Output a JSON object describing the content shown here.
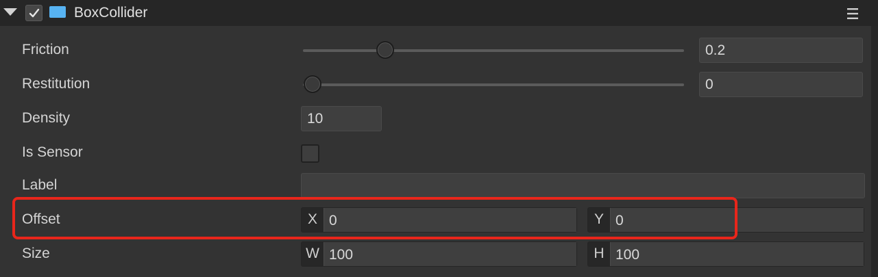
{
  "component": {
    "title": "BoxCollider",
    "enabled": true,
    "accent_color": "#57b3f2",
    "icons": [
      "fold-arrow-icon",
      "checkmark-icon",
      "component-icon",
      "menu-icon"
    ]
  },
  "properties": {
    "friction": {
      "label": "Friction",
      "value": "0.2",
      "slider_fraction": 0.2
    },
    "restitution": {
      "label": "Restitution",
      "value": "0",
      "slider_fraction": 0.0
    },
    "density": {
      "label": "Density",
      "value": "10"
    },
    "is_sensor": {
      "label": "Is Sensor",
      "checked": false
    },
    "label": {
      "label": "Label",
      "value": ""
    },
    "offset": {
      "label": "Offset",
      "x_label": "X",
      "x_value": "0",
      "y_label": "Y",
      "y_value": "0"
    },
    "size": {
      "label": "Size",
      "w_label": "W",
      "w_value": "100",
      "h_label": "H",
      "h_value": "100"
    }
  },
  "highlight_color": "#e8261b"
}
